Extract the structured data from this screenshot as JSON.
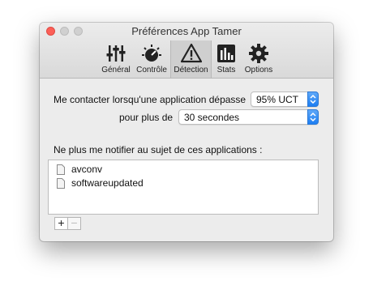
{
  "window": {
    "title": "Préférences App Tamer"
  },
  "toolbar": {
    "items": [
      {
        "label": "Général",
        "icon": "sliders-icon"
      },
      {
        "label": "Contrôle",
        "icon": "speedometer-icon"
      },
      {
        "label": "Détection",
        "icon": "warning-triangle-icon",
        "selected": true
      },
      {
        "label": "Stats",
        "icon": "bar-chart-icon"
      },
      {
        "label": "Options",
        "icon": "gear-icon"
      }
    ]
  },
  "detection": {
    "threshold_label": "Me contacter lorsqu'une application dépasse",
    "threshold_value": "95% UCT",
    "duration_label": "pour plus de",
    "duration_value": "30 secondes",
    "exclusions_label": "Ne plus me notifier au sujet de ces applications :",
    "apps": [
      "avconv",
      "softwareupdated"
    ],
    "add_label": "+",
    "remove_label": "−"
  },
  "colors": {
    "accent": "#1d7ef2",
    "close": "#fc5f57"
  }
}
